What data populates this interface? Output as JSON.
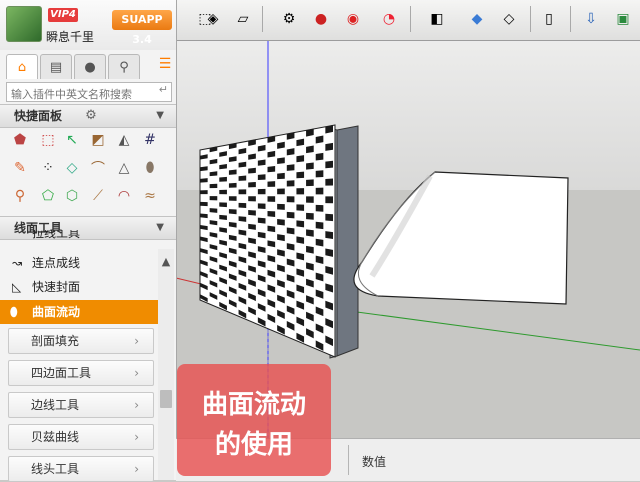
{
  "toolbar": {
    "icons": [
      "arrow-box-icon",
      "push-pull-icon",
      "eraser-icon",
      "gears-icon",
      "red-button-icon",
      "red-dome-icon",
      "rss-icon",
      "cube-icon",
      "texture-cube-icon",
      "outline-cube-icon",
      "door-icon",
      "download-box-icon",
      "green-box-icon"
    ]
  },
  "panel": {
    "vip_badge": "VIP4",
    "username": "瞬息千里",
    "suapp_badge": "SUAPP 3.4",
    "tabs": [
      "home-icon",
      "keyboard-icon",
      "user-icon",
      "search-icon"
    ],
    "search": {
      "placeholder": "输入插件中英文名称搜索"
    },
    "quick_panel": {
      "title": "快捷面板"
    },
    "line_tools": {
      "title": "线面工具"
    },
    "items": [
      {
        "label": "拉线工具",
        "icon": "line-icon"
      },
      {
        "label": "连点成线",
        "icon": "connect-dots-icon"
      },
      {
        "label": "快速封面",
        "icon": "seal-face-icon"
      },
      {
        "label": "曲面流动",
        "icon": "surface-flow-icon"
      }
    ],
    "submenus": [
      "剖面填充",
      "四边面工具",
      "边线工具",
      "贝兹曲线",
      "线头工具"
    ]
  },
  "status": {
    "value_label": "数值"
  },
  "caption": {
    "line1": "曲面流动",
    "line2": "的使用"
  },
  "colors": {
    "accent": "#f08c00",
    "caption": "#e85252"
  }
}
